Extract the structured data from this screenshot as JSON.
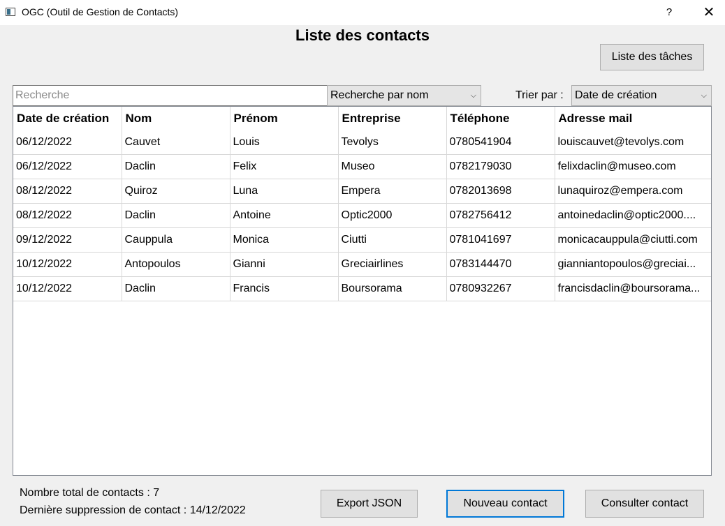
{
  "window": {
    "title": "OGC (Outil de Gestion de Contacts)",
    "help": "?",
    "close": "✕"
  },
  "page": {
    "title": "Liste des contacts"
  },
  "tasks_button": "Liste des tâches",
  "search": {
    "placeholder": "Recherche",
    "value": ""
  },
  "search_mode": {
    "selected": "Recherche par nom"
  },
  "sort": {
    "label": "Trier par :",
    "selected": "Date de création"
  },
  "table": {
    "headers": [
      "Date de création",
      "Nom",
      "Prénom",
      "Entreprise",
      "Téléphone",
      "Adresse mail"
    ],
    "rows": [
      [
        "06/12/2022",
        "Cauvet",
        "Louis",
        "Tevolys",
        "0780541904",
        "louiscauvet@tevolys.com"
      ],
      [
        "06/12/2022",
        "Daclin",
        "Felix",
        "Museo",
        "0782179030",
        "felixdaclin@museo.com"
      ],
      [
        "08/12/2022",
        "Quiroz",
        "Luna",
        "Empera",
        "0782013698",
        "lunaquiroz@empera.com"
      ],
      [
        "08/12/2022",
        "Daclin",
        "Antoine",
        "Optic2000",
        "0782756412",
        "antoinedaclin@optic2000...."
      ],
      [
        "09/12/2022",
        "Cauppula",
        "Monica",
        "Ciutti",
        "0781041697",
        "monicacauppula@ciutti.com"
      ],
      [
        "10/12/2022",
        "Antopoulos",
        "Gianni",
        "Greciairlines",
        "0783144470",
        "gianniantopoulos@greciai..."
      ],
      [
        "10/12/2022",
        "Daclin",
        "Francis",
        "Boursorama",
        "0780932267",
        "francisdaclin@boursorama..."
      ]
    ]
  },
  "stats": {
    "total": "Nombre total de contacts :  7",
    "last_deletion": "Dernière suppression de contact : 14/12/2022"
  },
  "buttons": {
    "export": "Export JSON",
    "new": "Nouveau contact",
    "view": "Consulter contact"
  }
}
